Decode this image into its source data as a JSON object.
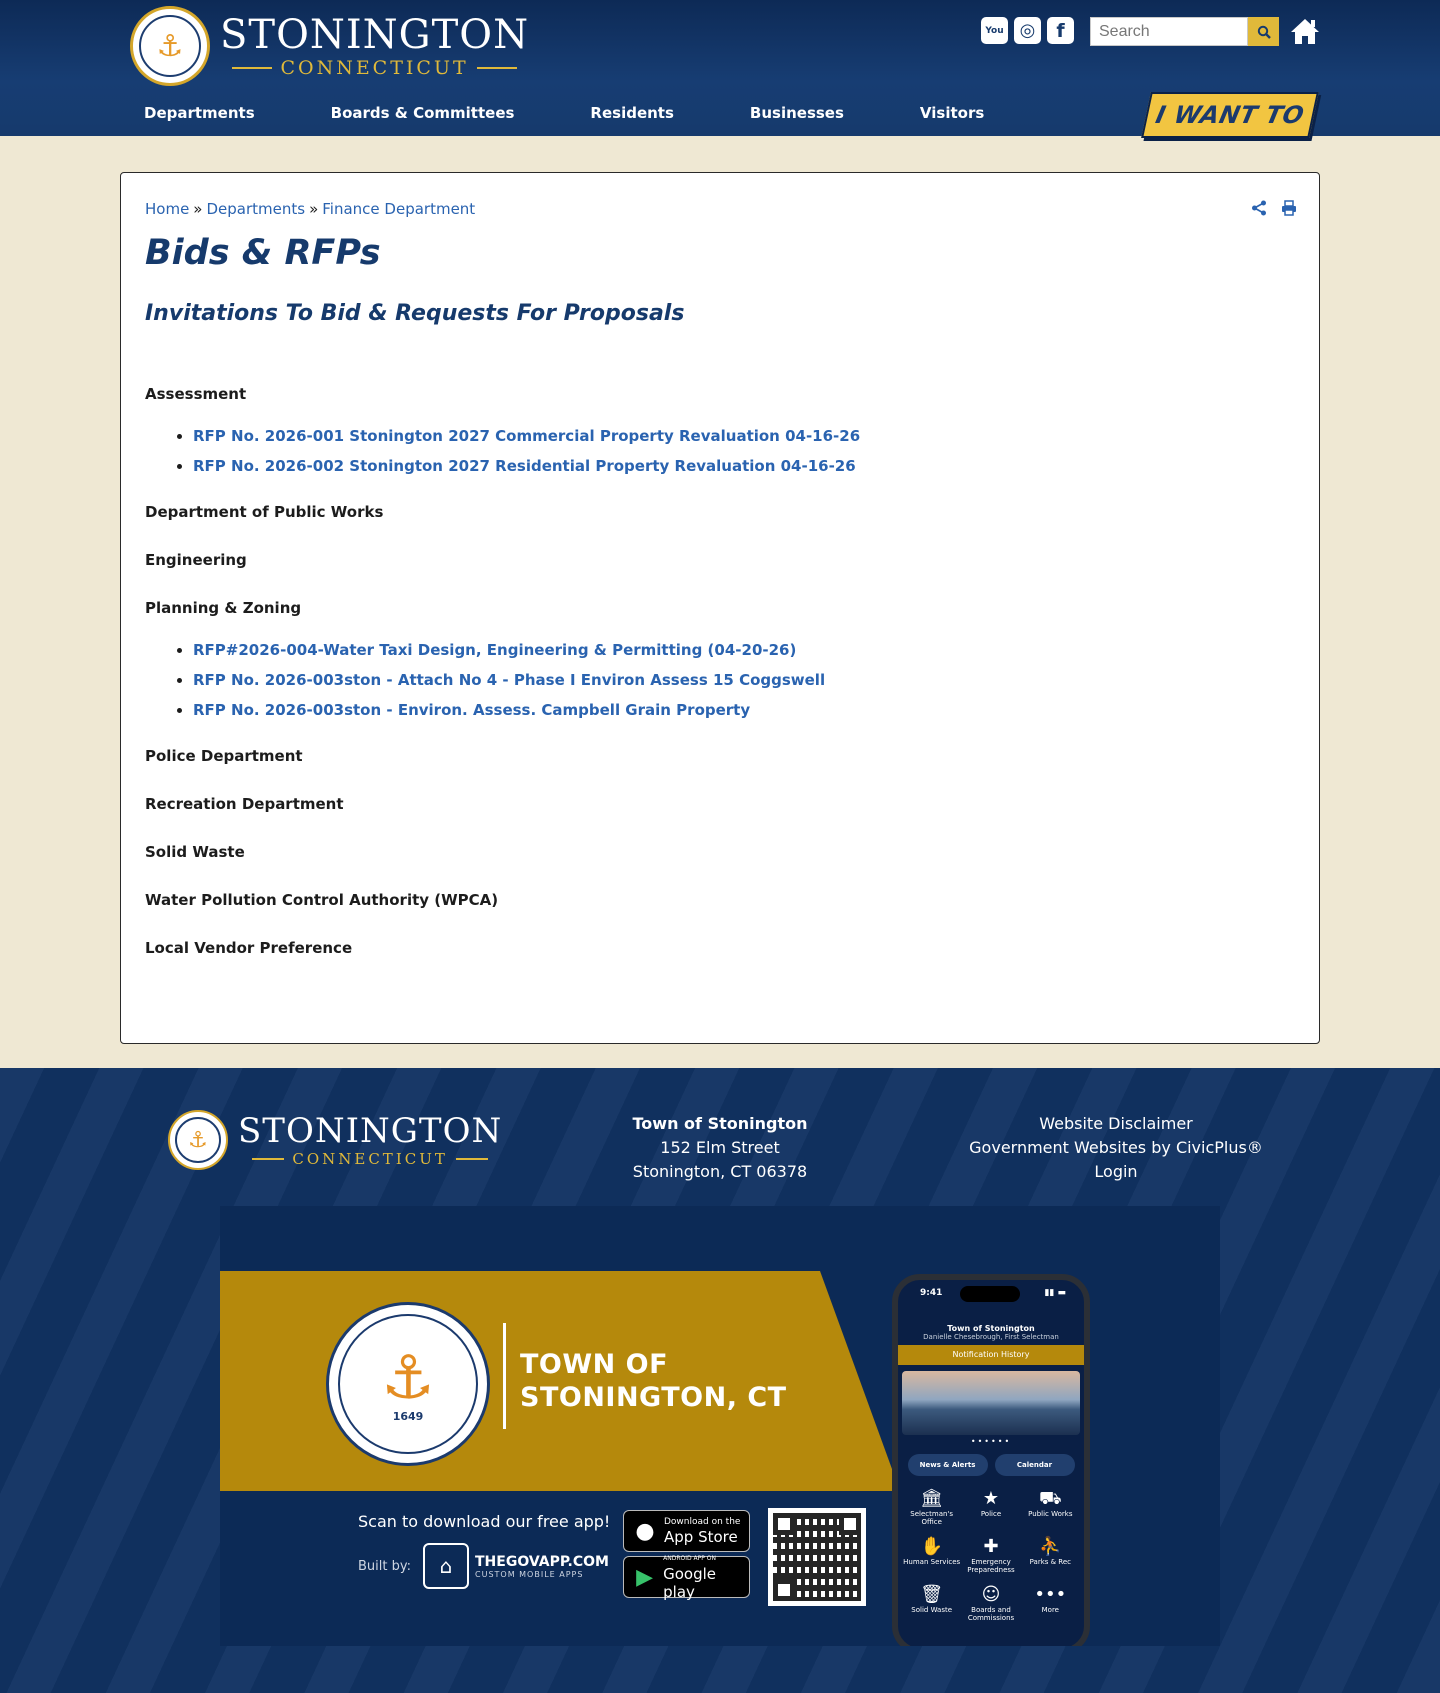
{
  "header": {
    "logo_name": "STONINGTON",
    "logo_sub": "CONNECTICUT",
    "social": [
      {
        "icon": "youtube-icon",
        "glyph": "You"
      },
      {
        "icon": "instagram-icon",
        "glyph": "◎"
      },
      {
        "icon": "facebook-icon",
        "glyph": "f"
      }
    ],
    "search_placeholder": "Search",
    "nav": [
      "Departments",
      "Boards & Committees",
      "Residents",
      "Businesses",
      "Visitors"
    ],
    "i_want_to": "I WANT TO"
  },
  "breadcrumb": {
    "home": "Home",
    "sep1": "»",
    "departments": "Departments",
    "sep2": "»",
    "finance": "Finance Department"
  },
  "page": {
    "title": "Bids & RFPs",
    "subtitle": "Invitations To Bid & Requests For Proposals"
  },
  "sections": [
    {
      "heading": "Assessment",
      "items": [
        "RFP No. 2026-001 Stonington 2027 Commercial Property Revaluation 04-16-26",
        "RFP No. 2026-002 Stonington 2027 Residential Property Revaluation 04-16-26"
      ]
    },
    {
      "heading": "Department of Public Works",
      "items": []
    },
    {
      "heading": "Engineering",
      "items": []
    },
    {
      "heading": "Planning & Zoning",
      "items": [
        "RFP#2026-004-Water Taxi Design, Engineering & Permitting (04-20-26)",
        "RFP No. 2026-003ston - Attach No 4 - Phase I Environ Assess 15 Coggswell",
        "RFP No. 2026-003ston - Environ. Assess. Campbell Grain Property"
      ]
    },
    {
      "heading": "Police Department",
      "items": []
    },
    {
      "heading": "Recreation Department",
      "items": []
    },
    {
      "heading": "Solid Waste",
      "items": []
    },
    {
      "heading": "Water Pollution Control Authority (WPCA)",
      "items": []
    },
    {
      "heading": "Local Vendor Preference",
      "items": []
    }
  ],
  "footer": {
    "logo_name": "STONINGTON",
    "logo_sub": "CONNECTICUT",
    "town": "Town of Stonington",
    "street": "152 Elm Street",
    "city": "Stonington, CT 06378",
    "links": [
      "Website Disclaimer",
      "Government Websites by CivicPlus®",
      "Login"
    ]
  },
  "app_banner": {
    "seal_year": "1649",
    "title_line1": "TOWN OF",
    "title_line2": "STONINGTON, CT",
    "scan_text": "Scan to download our free app!",
    "built_by": "Built by:",
    "govapp_name": "THEGOVAPP.COM",
    "govapp_tag": "CUSTOM MOBILE APPS",
    "appstore_line1": "Download on the",
    "appstore_line2": "App Store",
    "googleplay_line1": "ANDROID APP ON",
    "googleplay_line2": "Google play",
    "phone": {
      "time": "9:41",
      "town": "Town of Stonington",
      "sub": "Danielle Chesebrough, First Selectman",
      "notification": "Notification History",
      "tabs": [
        "News & Alerts",
        "Calendar"
      ],
      "tiles": [
        {
          "icon": "bank-icon",
          "glyph": "🏛",
          "label": "Selectman's Office"
        },
        {
          "icon": "badge-icon",
          "glyph": "★",
          "label": "Police"
        },
        {
          "icon": "truck-icon",
          "glyph": "⛟",
          "label": "Public Works"
        },
        {
          "icon": "handshake-icon",
          "glyph": "✋",
          "label": "Human Services"
        },
        {
          "icon": "cross-icon",
          "glyph": "✚",
          "label": "Emergency Preparedness"
        },
        {
          "icon": "playground-icon",
          "glyph": "⛹",
          "label": "Parks & Rec"
        },
        {
          "icon": "trash-icon",
          "glyph": "🗑",
          "label": "Solid Waste"
        },
        {
          "icon": "people-icon",
          "glyph": "☺",
          "label": "Boards and Commissions"
        },
        {
          "icon": "more-icon",
          "glyph": "•••",
          "label": "More"
        }
      ]
    }
  },
  "colors": {
    "navy": "#163a6c",
    "gold": "#e0b93a",
    "link": "#2a63b0",
    "background": "#efe8d3"
  }
}
